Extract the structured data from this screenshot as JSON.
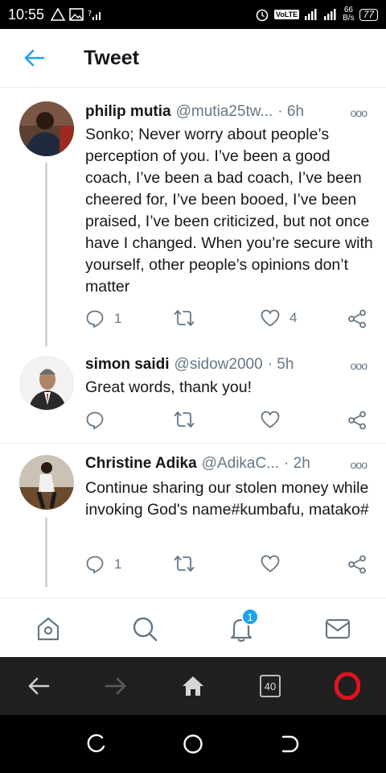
{
  "status_bar": {
    "time": "10:55",
    "volte": "VoLTE",
    "net_speed_value": "66",
    "net_speed_unit": "B/s",
    "battery": "77"
  },
  "header": {
    "title": "Tweet"
  },
  "tweets": [
    {
      "name": "philip mutia",
      "handle": "@mutia25tw...",
      "time": "· 6h",
      "text": "Sonko; Never worry about people’s perception of you. I’ve been a good coach, I’ve been a bad coach, I’ve been cheered for, I’ve been booed, I’ve been praised, I’ve been criticized, but not once have I changed. When you’re secure with yourself, other people’s opinions don’t matter",
      "replies": "1",
      "retweets": "",
      "likes": "4"
    },
    {
      "name": "simon saidi",
      "handle": "@sidow2000",
      "time": "· 5h",
      "text": "Great words, thank you!",
      "replies": "",
      "retweets": "",
      "likes": ""
    },
    {
      "name": "Christine Adika",
      "handle": "@AdikaC...",
      "time": "· 2h",
      "text": "Continue sharing our stolen money while invoking God's name#kumbafu, matako#",
      "replies": "1",
      "retweets": "",
      "likes": ""
    }
  ],
  "bottom_nav": {
    "notifications_badge": "1"
  },
  "browser_bar": {
    "tab_count": "40"
  },
  "colors": {
    "accent": "#1da1f2",
    "muted": "#657786",
    "opera_red": "#e0141e"
  }
}
